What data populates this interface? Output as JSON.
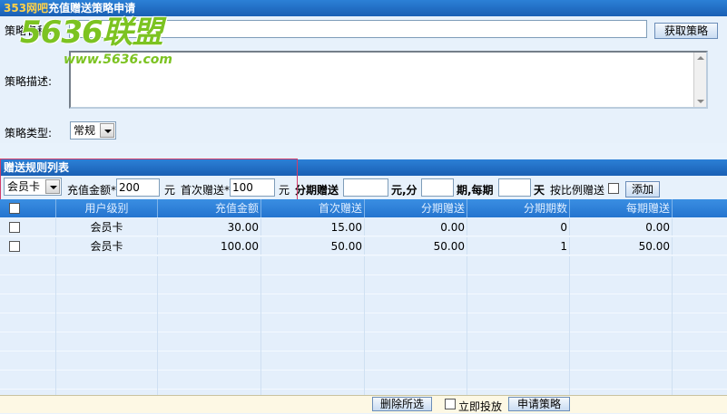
{
  "window": {
    "brand": "353网吧",
    "title": "充值赠送策略申请"
  },
  "watermark": {
    "logo": "5636联盟",
    "url": "www.5636.com"
  },
  "form": {
    "name_label": "策略名称:",
    "fetch_button": "获取策略",
    "desc_label": "策略描述:",
    "type_label": "策略类型:",
    "type_value": "常规"
  },
  "rules": {
    "section_title": "赠送规则列表",
    "level_value": "会员卡",
    "charge_label": "充值金额*",
    "charge_value": "200",
    "unit_yuan": "元",
    "first_label": "首次赠送*",
    "first_value": "100",
    "installment_label": "分期赠送",
    "yuan_fen_label": "元,分",
    "period_each_label": "期,每期",
    "day_label": "天",
    "ratio_label": "按比例赠送",
    "add_button": "添加"
  },
  "table": {
    "columns": [
      "用户级别",
      "充值金额",
      "首次赠送",
      "分期赠送",
      "分期期数",
      "每期赠送"
    ],
    "rows": [
      [
        "会员卡",
        "30.00",
        "15.00",
        "0.00",
        "0",
        "0.00"
      ],
      [
        "会员卡",
        "100.00",
        "50.00",
        "50.00",
        "1",
        "50.00"
      ]
    ]
  },
  "footer": {
    "delete_button": "删除所选",
    "publish_label": "立即投放",
    "apply_button": "申请策略"
  }
}
